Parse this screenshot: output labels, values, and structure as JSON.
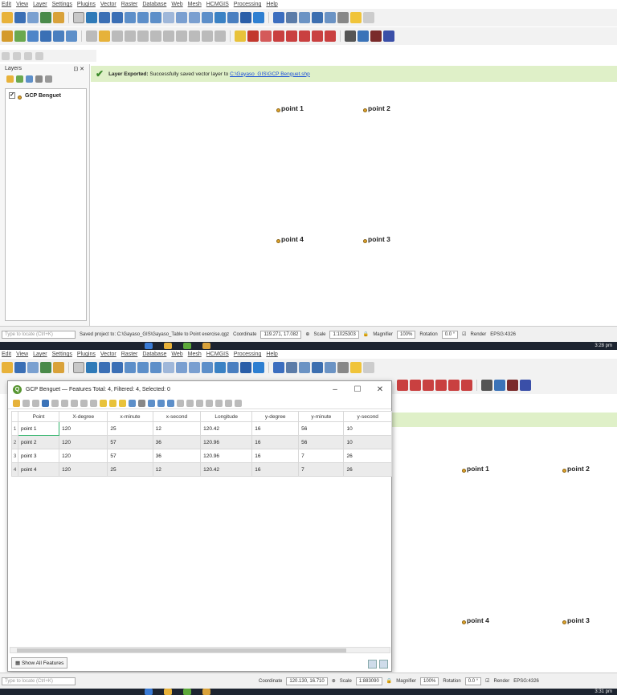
{
  "menu": [
    "Edit",
    "View",
    "Layer",
    "Settings",
    "Plugins",
    "Vector",
    "Raster",
    "Database",
    "Web",
    "Mesh",
    "HCMGIS",
    "Processing",
    "Help"
  ],
  "colors": {
    "message_bg": "#dff0c8",
    "point_fill": "#e0a32a",
    "link": "#1a4ed8",
    "select_border": "#2fb36a"
  },
  "layers_panel": {
    "title": "Layers",
    "layer_name": "GCP Benguet"
  },
  "message": {
    "label": "Layer Exported:",
    "text": "Successfully saved vector layer to",
    "link": "C:\\Gayaso_GIS\\GCP Benguet.shp"
  },
  "points": [
    "point 1",
    "point 2",
    "point 4",
    "point 3"
  ],
  "status_top": {
    "saved": "Saved project to: C:\\Gayaso_GIS\\Gayaso_Table to Point exercise.qgz",
    "search_placeholder": "Type to locate (Ctrl+K)",
    "coord_label": "Coordinate",
    "coord": "119.271, 17.082",
    "scale_label": "Scale",
    "scale": "1:1025303",
    "magnifier_label": "Magnifier",
    "magnifier": "100%",
    "rotation_label": "Rotation",
    "rotation": "0.0 °",
    "render": "Render",
    "crs": "EPSG:4326"
  },
  "status_bottom": {
    "coord": "120.130, 16.710",
    "scale": "1:883090",
    "search_placeholder": "Type to locate (Ctrl+K)"
  },
  "taskbar": {
    "time_top": "3:28 pm",
    "time_bottom": "3:31 pm"
  },
  "attr_window": {
    "title": "GCP Benguet — Features Total: 4, Filtered: 4, Selected: 0",
    "columns": [
      "Point",
      "X-degree",
      "x-minute",
      "x-second",
      "Longitude",
      "y-degree",
      "y-minute",
      "y-second"
    ],
    "rows": [
      [
        "point 1",
        "120",
        "25",
        "12",
        "120.42",
        "16",
        "56",
        "10"
      ],
      [
        "point 2",
        "120",
        "57",
        "36",
        "120.96",
        "16",
        "56",
        "10"
      ],
      [
        "point 3",
        "120",
        "57",
        "36",
        "120.96",
        "16",
        "7",
        "26"
      ],
      [
        "point 4",
        "120",
        "25",
        "12",
        "120.42",
        "16",
        "7",
        "26"
      ]
    ],
    "show_all": "Show All Features"
  }
}
